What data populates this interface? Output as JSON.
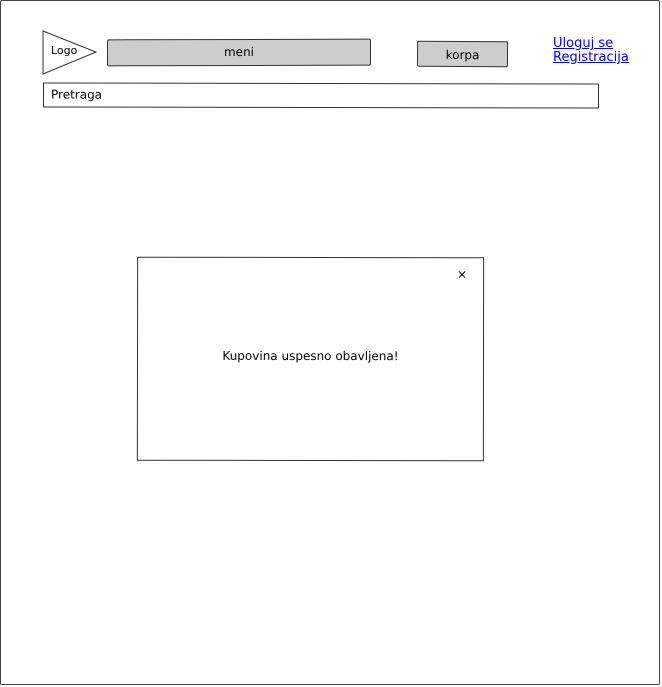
{
  "header": {
    "logo_label": "Logo",
    "menu_label": "meni",
    "cart_label": "korpa",
    "login_link": "Uloguj se",
    "register_link": "Registracija"
  },
  "search": {
    "placeholder": "Pretraga"
  },
  "modal": {
    "close_label": "×",
    "message": "Kupovina uspesno obavljena!"
  }
}
